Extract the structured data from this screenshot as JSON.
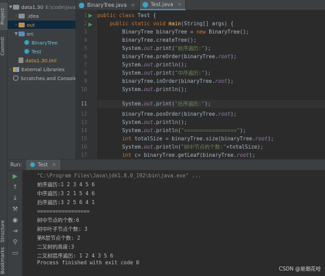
{
  "sidebar": {
    "tabs": [
      "Project",
      "Commit",
      "Structure",
      "Bookmarks"
    ]
  },
  "project": {
    "root_name": "data1.30",
    "root_path": "E:\\code\\java",
    "items": [
      {
        "label": ".idea"
      },
      {
        "label": "out"
      },
      {
        "label": "src"
      },
      {
        "label": "BinaryTree"
      },
      {
        "label": "Test"
      },
      {
        "label": "data1.30.iml"
      },
      {
        "label": "External Libraries"
      },
      {
        "label": "Scratches and Consoles"
      }
    ]
  },
  "editor": {
    "tabs": [
      {
        "label": "BinaryTree.java",
        "active": false
      },
      {
        "label": "Test.java",
        "active": true
      }
    ],
    "line_numbers": [
      "1",
      "2",
      "3",
      "4",
      "5",
      "6",
      "7",
      "8",
      "9",
      "10",
      "11",
      "12",
      "13",
      "14",
      "15",
      "16",
      "17",
      "18"
    ],
    "current_line": 11
  },
  "run": {
    "label": "Run:",
    "tab": "Test",
    "console": [
      "\"C:\\Program Files\\Java\\jdk1.8.0_192\\bin\\java.exe\" ...",
      "前序遍历:1 2 3 4 5 6",
      "中序遍历:3 2 1 5 4 6",
      "后序遍历:3 2 5 6 4 1",
      "=================",
      "树中节点的个数:6",
      "树中叶子节点个数: 3",
      "第K层节点个数: 2",
      "二叉树的高度:3",
      "二叉树层序遍历: 1 2 4 3 5 6",
      "",
      "Process finished with exit code 0"
    ]
  },
  "watermark": "CSDN @是烟花哈",
  "colors": {
    "background": "#2b2b2b",
    "keyword": "#cc7832",
    "string": "#6a8759",
    "method": "#ffc66d",
    "field": "#9876aa",
    "run_green": "#59a869"
  },
  "icons": {
    "run_toolbar": [
      "run-icon",
      "up-arrow-icon",
      "down-arrow-icon",
      "wrench-icon",
      "camera-icon",
      "exit-icon",
      "pin-icon",
      "trash-icon"
    ]
  }
}
